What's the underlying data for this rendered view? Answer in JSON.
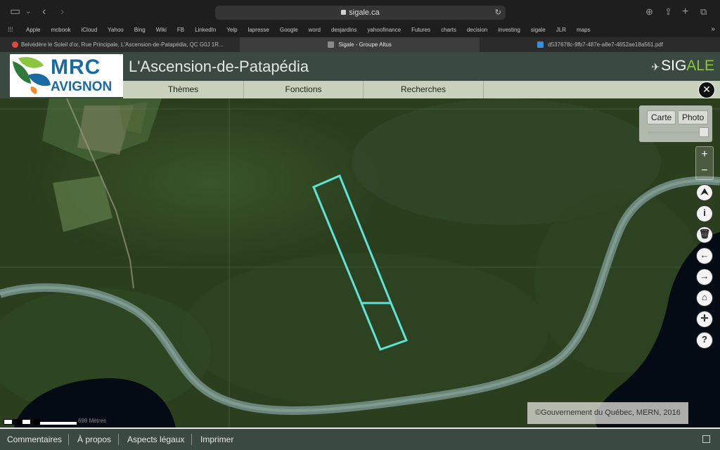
{
  "browser": {
    "url": "sigale.ca",
    "favorites": [
      "Apple",
      "mcbook",
      "iCloud",
      "Yahoo",
      "Bing",
      "Wiki",
      "FB",
      "LinkedIn",
      "Yelp",
      "lapresse",
      "Google",
      "word",
      "desjardins",
      "yahoofinance",
      "Futures",
      "charts",
      "decision",
      "investing",
      "sigale",
      "JLR",
      "maps"
    ],
    "tabs": [
      {
        "label": "Belvédère le Soleil d'or, Rue Principale, L'Ascension-de-Patapédia, QC G0J 1R...",
        "active": false
      },
      {
        "label": "Sigale - Groupe Altus",
        "active": true
      },
      {
        "label": "d537678c-9fb7-487e-a8e7-4652ae18a561.pdf",
        "active": false
      }
    ]
  },
  "header": {
    "logo_line1": "MRC",
    "logo_line2": "AVIGNON",
    "title": "L'Ascension-de-Patapédia",
    "brand_prefix": "SIG",
    "brand_suffix": "ALE"
  },
  "menu": [
    "Thèmes",
    "Fonctions",
    "Recherches"
  ],
  "basemap": {
    "carte": "Carte",
    "photo": "Photo",
    "opacity": 1.0
  },
  "tools": [
    "zoom-in",
    "zoom-out",
    "north-arrow",
    "info",
    "delete",
    "back",
    "forward",
    "home",
    "locate",
    "help"
  ],
  "map": {
    "copyright": "©Gouvernement du Québec, MERN, 2016",
    "scale_label": "698 Mètres"
  },
  "footer": [
    "Commentaires",
    "À propos",
    "Aspects légaux",
    "Imprimer"
  ],
  "colors": {
    "header_bg": "#3a4a40",
    "menu_bg": "#c9d1bd",
    "parcel_outline": "#5ee3d6",
    "river": "#6e8a80",
    "lake": "#050b14"
  }
}
